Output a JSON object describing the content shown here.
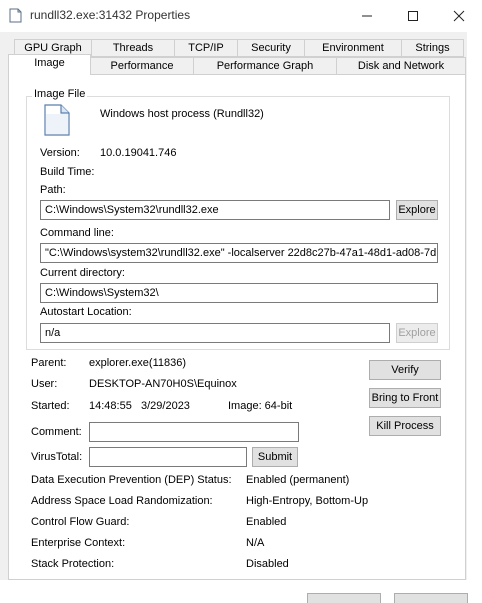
{
  "window": {
    "title": "rundll32.exe:31432 Properties",
    "minimize_icon": "minimize-icon",
    "maximize_icon": "maximize-icon",
    "close_icon": "close-icon"
  },
  "tabs_row1": [
    "GPU Graph",
    "Threads",
    "TCP/IP",
    "Security",
    "Environment",
    "Strings"
  ],
  "tabs_row2": [
    "Image",
    "Performance",
    "Performance Graph",
    "Disk and Network"
  ],
  "selected_tab": "Image",
  "image_file": {
    "group_label": "Image File",
    "description": "Windows host process (Rundll32)",
    "version_label": "Version:",
    "version_value": "10.0.19041.746",
    "build_time_label": "Build Time:",
    "path_label": "Path:",
    "path_value": "C:\\Windows\\System32\\rundll32.exe",
    "explore_label": "Explore",
    "command_line_label": "Command line:",
    "command_line_value": "\"C:\\Windows\\system32\\rundll32.exe\" -localserver 22d8c27b-47a1-48d1-ad08-7d",
    "current_directory_label": "Current directory:",
    "current_directory_value": "C:\\Windows\\System32\\",
    "autostart_label": "Autostart Location:",
    "autostart_value": "n/a",
    "explore2_label": "Explore"
  },
  "details": {
    "parent_label": "Parent:",
    "parent_value": "explorer.exe(11836)",
    "user_label": "User:",
    "user_value": "DESKTOP-AN70H0S\\Equinox",
    "started_label": "Started:",
    "started_value": "14:48:55   3/29/2023",
    "image_bits": "Image: 64-bit",
    "comment_label": "Comment:",
    "virustotal_label": "VirusTotal:",
    "submit_label": "Submit",
    "verify_label": "Verify",
    "bring_to_front_label": "Bring to Front",
    "kill_process_label": "Kill Process"
  },
  "security": [
    {
      "label": "Data Execution Prevention (DEP) Status:",
      "value": "Enabled (permanent)"
    },
    {
      "label": "Address Space Load Randomization:",
      "value": "High-Entropy, Bottom-Up"
    },
    {
      "label": "Control Flow Guard:",
      "value": "Enabled"
    },
    {
      "label": "Enterprise Context:",
      "value": "N/A"
    },
    {
      "label": "Stack Protection:",
      "value": "Disabled"
    }
  ]
}
